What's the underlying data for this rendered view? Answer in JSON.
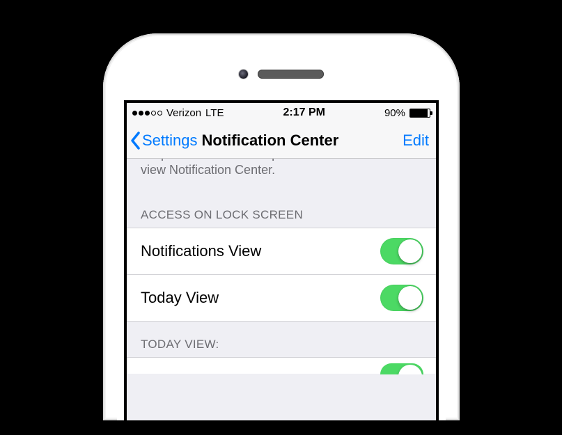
{
  "statusbar": {
    "signal_filled": 3,
    "signal_total": 5,
    "carrier": "Verizon",
    "network": "LTE",
    "time": "2:17 PM",
    "battery_percent": "90%",
    "battery_level": 90
  },
  "navbar": {
    "back_label": "Settings",
    "title": "Notification Center",
    "edit_label": "Edit"
  },
  "help": {
    "line1": "Swipe down from the top of the screen to",
    "line2": "view Notification Center."
  },
  "sections": {
    "access_header": "ACCESS ON LOCK SCREEN",
    "notifications_view": {
      "label": "Notifications View",
      "on": true
    },
    "today_view": {
      "label": "Today View",
      "on": true
    },
    "today_header": "TODAY VIEW:"
  },
  "colors": {
    "tint": "#007aff",
    "switch_on": "#4cd964",
    "bg": "#efeff4"
  }
}
